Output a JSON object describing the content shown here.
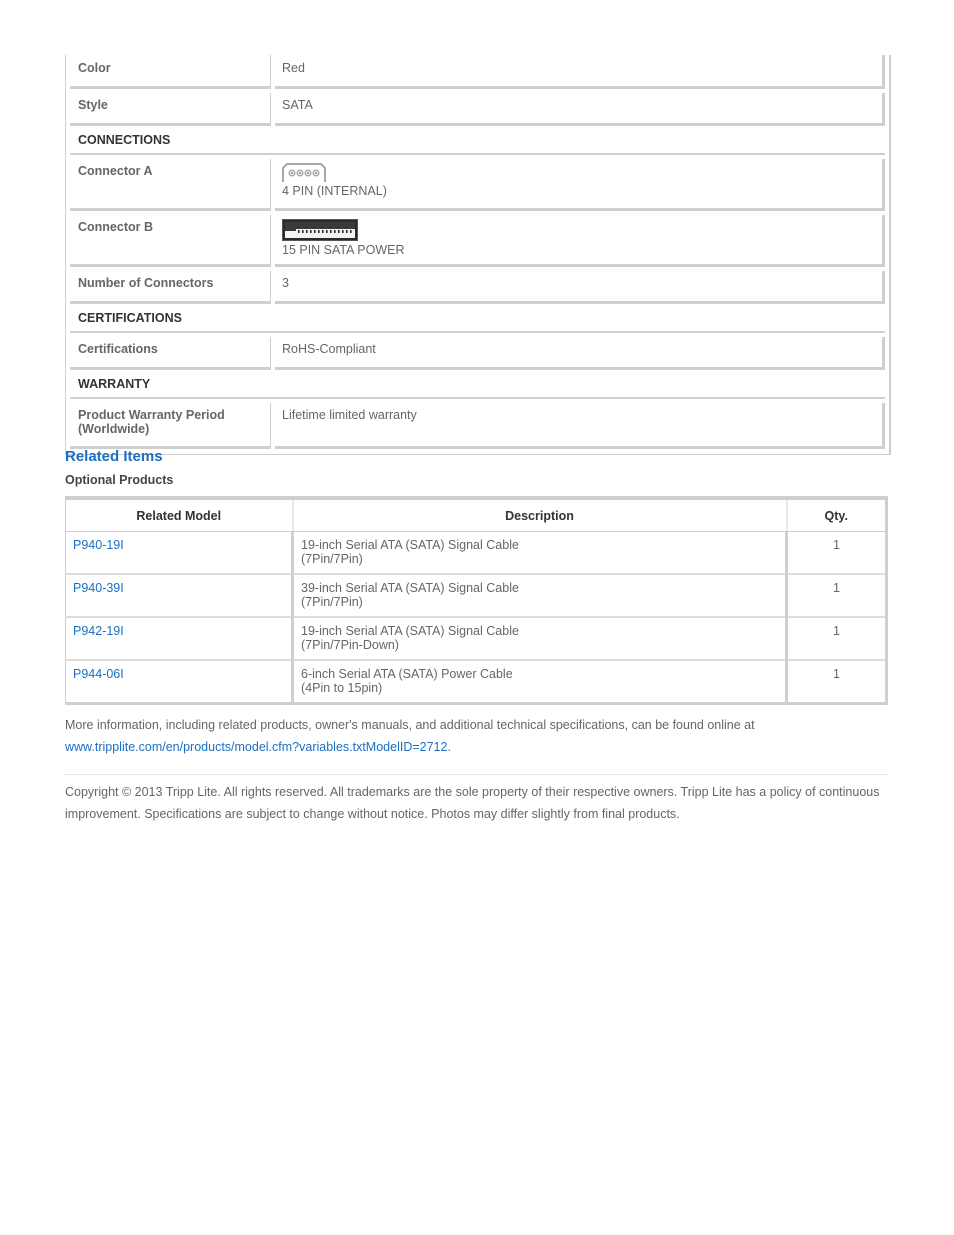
{
  "specs": {
    "color": {
      "label": "Color",
      "value": "Red"
    },
    "style": {
      "label": "Style",
      "value": "SATA"
    },
    "sections": {
      "connections": "CONNECTIONS",
      "certifications": "CERTIFICATIONS",
      "warranty": "WARRANTY"
    },
    "connector_a": {
      "label": "Connector A",
      "value": "4 PIN (INTERNAL)",
      "icon": "4-pin-molex-connector-icon"
    },
    "connector_b": {
      "label": "Connector B",
      "value": "15 PIN SATA POWER",
      "icon": "15-pin-sata-power-connector-icon"
    },
    "num_connectors": {
      "label": "Number of Connectors",
      "value": "3"
    },
    "certifications": {
      "label": "Certifications",
      "value": "RoHS-Compliant"
    },
    "warranty": {
      "label_line1": "Product Warranty Period",
      "label_line2": "(Worldwide)",
      "value": "Lifetime limited warranty"
    }
  },
  "related": {
    "title": "Related Items",
    "subtitle": "Optional Products",
    "columns": [
      "Related Model",
      "Description",
      "Qty."
    ],
    "rows": [
      {
        "model": "P940-19I",
        "desc_line1": "19-inch Serial ATA (SATA) Signal Cable",
        "desc_line2": "(7Pin/7Pin)",
        "qty": "1"
      },
      {
        "model": "P940-39I",
        "desc_line1": "39-inch Serial ATA (SATA) Signal Cable",
        "desc_line2": "(7Pin/7Pin)",
        "qty": "1"
      },
      {
        "model": "P942-19I",
        "desc_line1": "19-inch Serial ATA (SATA) Signal Cable",
        "desc_line2": "(7Pin/7Pin-Down)",
        "qty": "1"
      },
      {
        "model": "P944-06I",
        "desc_line1": "6-inch Serial ATA (SATA) Power Cable",
        "desc_line2": "(4Pin to 15pin)",
        "qty": "1"
      }
    ]
  },
  "footer": {
    "more_info": "More information, including related products, owner's manuals, and additional technical specifications, can be found online at",
    "link": "www.tripplite.com/en/products/model.cfm?variables.txtModelID=2712",
    "link_suffix": ".",
    "copyright": "Copyright © 2013 Tripp Lite. All rights reserved. All trademarks are the sole property of their respective owners. Tripp Lite has a policy of continuous improvement. Specifications are subject to change without notice. Photos may differ slightly from final products."
  },
  "colors": {
    "link": "#1a6fc4",
    "text": "#666666",
    "border": "#cfcfcf"
  }
}
